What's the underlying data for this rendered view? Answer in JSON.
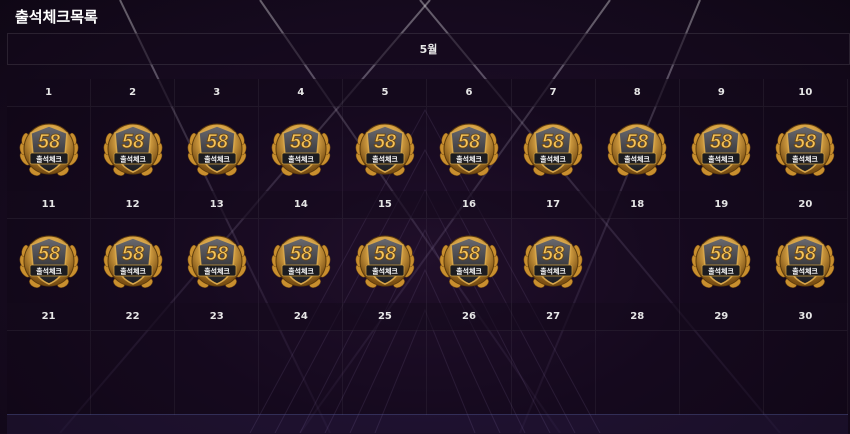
{
  "page": {
    "title": "출석체크목록"
  },
  "calendar": {
    "month_label": "5월",
    "weeks": [
      {
        "days": [
          {
            "day": "1",
            "checked": true
          },
          {
            "day": "2",
            "checked": true
          },
          {
            "day": "3",
            "checked": true
          },
          {
            "day": "4",
            "checked": true
          },
          {
            "day": "5",
            "checked": true
          },
          {
            "day": "6",
            "checked": true
          },
          {
            "day": "7",
            "checked": true
          },
          {
            "day": "8",
            "checked": true
          },
          {
            "day": "9",
            "checked": true
          },
          {
            "day": "10",
            "checked": true
          }
        ]
      },
      {
        "days": [
          {
            "day": "11",
            "checked": true
          },
          {
            "day": "12",
            "checked": true
          },
          {
            "day": "13",
            "checked": true
          },
          {
            "day": "14",
            "checked": true
          },
          {
            "day": "15",
            "checked": true
          },
          {
            "day": "16",
            "checked": true
          },
          {
            "day": "17",
            "checked": true
          },
          {
            "day": "18",
            "checked": false
          },
          {
            "day": "19",
            "checked": true
          },
          {
            "day": "20",
            "checked": true
          }
        ]
      },
      {
        "days": [
          {
            "day": "21",
            "checked": false
          },
          {
            "day": "22",
            "checked": false
          },
          {
            "day": "23",
            "checked": false
          },
          {
            "day": "24",
            "checked": false
          },
          {
            "day": "25",
            "checked": false
          },
          {
            "day": "26",
            "checked": false
          },
          {
            "day": "27",
            "checked": false
          },
          {
            "day": "28",
            "checked": false
          },
          {
            "day": "29",
            "checked": false
          },
          {
            "day": "30",
            "checked": false
          }
        ]
      }
    ]
  },
  "badge": {
    "logo_text": "58",
    "label": "출석체크",
    "icon": "attendance-stamp-icon",
    "colors": {
      "gold": "#d9a441",
      "gold_light": "#f6d27a",
      "dark": "#2a2a2e"
    }
  }
}
